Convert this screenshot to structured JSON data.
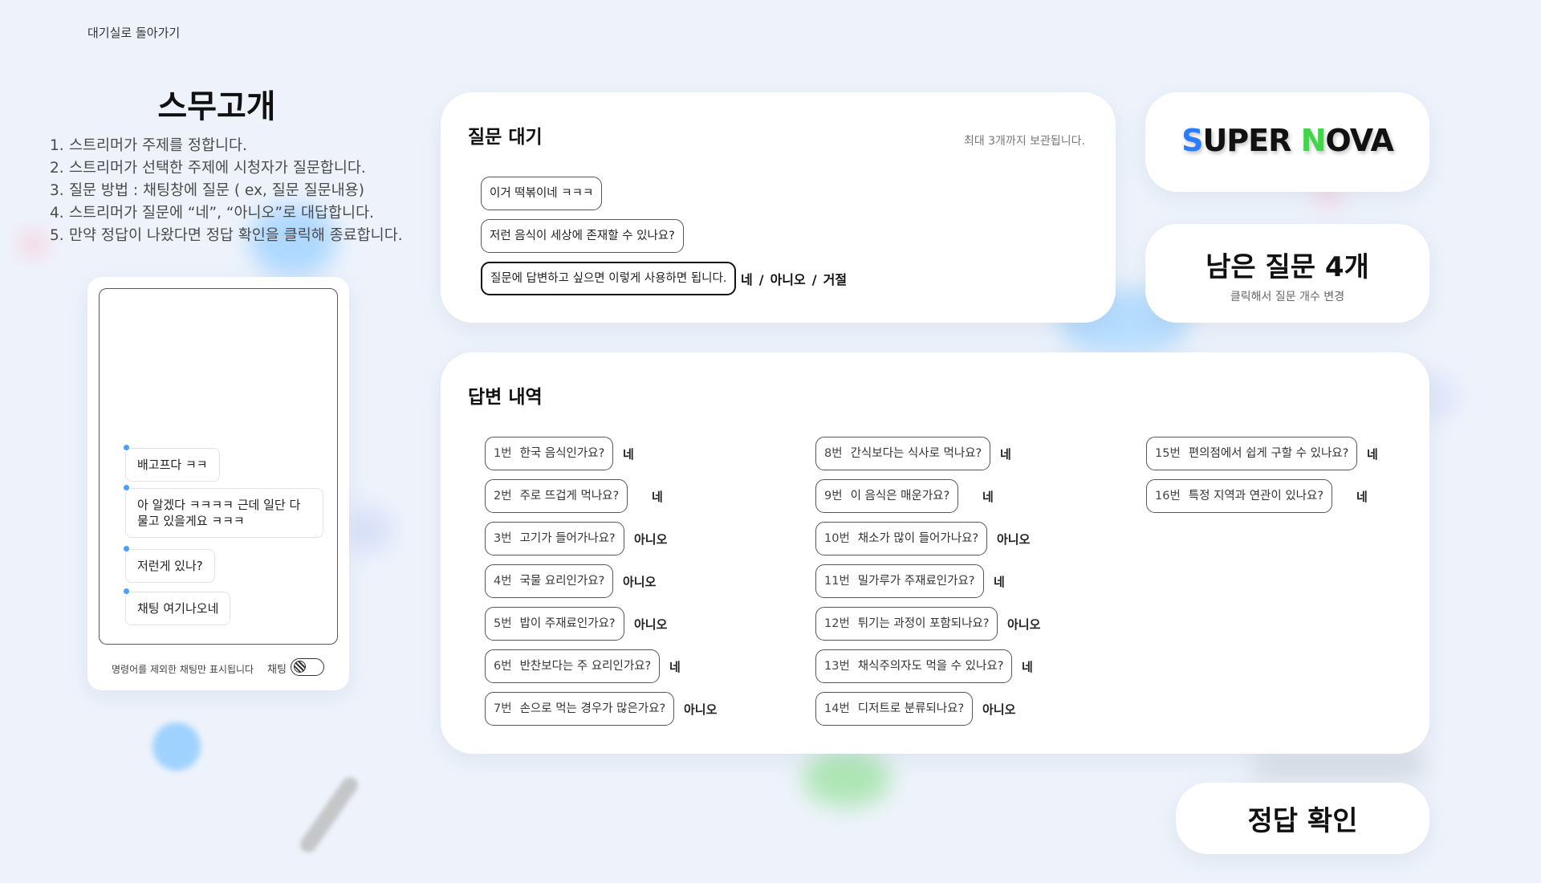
{
  "nav": {
    "back_label": "대기실로 돌아가기"
  },
  "game": {
    "title": "스무고개",
    "rules": [
      {
        "num": "1.",
        "text": "스트리머가 주제를 정합니다."
      },
      {
        "num": "2.",
        "text": "스트리머가 선택한 주제에 시청자가 질문합니다."
      },
      {
        "num": "3.",
        "text": "질문 방법 : 채팅창에 질문 ( ex, 질문 질문내용)"
      },
      {
        "num": "4.",
        "text": "스트리머가 질문에 “네”, “아니오”로 대답합니다."
      },
      {
        "num": "5.",
        "text": "만약 정답이 나왔다면 정답 확인을 클릭해 종료합니다."
      }
    ]
  },
  "chat": {
    "messages": [
      "배고프다 ㅋㅋ",
      "아 알겠다 ㅋㅋㅋㅋ 근데 일단 다물고 있을게요 ㅋㅋㅋ",
      "저런게 있나?",
      "채팅 여기나오네"
    ],
    "footer_note": "명령어를 제외한 채팅만 표시됩니다",
    "toggle_label": "채팅"
  },
  "queue": {
    "title": "질문 대기",
    "note": "최대 3개까지 보관됩니다.",
    "questions": [
      "이거 떡볶이네 ㅋㅋㅋ",
      "저런 음식이 세상에 존재할 수 있나요?",
      "질문에 답변하고 싶으면 이렇게 사용하면 됩니다."
    ],
    "options": {
      "yes": "네",
      "no": "아니오",
      "reject": "거절",
      "separator": "/"
    }
  },
  "brand": {
    "part1": "S",
    "part2": "UPER ",
    "part3": "N",
    "part4": "OVA"
  },
  "remaining": {
    "title": "남은 질문 4개",
    "subtitle": "클릭해서 질문 개수 변경",
    "count": 4
  },
  "history": {
    "title": "답변 내역",
    "items": [
      {
        "num": "1번",
        "q": "한국 음식인가요?",
        "a": "네"
      },
      {
        "num": "2번",
        "q": "주로 뜨겁게 먹나요?",
        "a": "네"
      },
      {
        "num": "3번",
        "q": "고기가 들어가나요?",
        "a": "아니오"
      },
      {
        "num": "4번",
        "q": "국물 요리인가요?",
        "a": "아니오"
      },
      {
        "num": "5번",
        "q": "밥이 주재료인가요?",
        "a": "아니오"
      },
      {
        "num": "6번",
        "q": "반찬보다는 주 요리인가요?",
        "a": "네"
      },
      {
        "num": "7번",
        "q": "손으로 먹는 경우가 많은가요?",
        "a": "아니오"
      },
      {
        "num": "8번",
        "q": "간식보다는 식사로 먹나요?",
        "a": "네"
      },
      {
        "num": "9번",
        "q": "이 음식은 매운가요?",
        "a": "네"
      },
      {
        "num": "10번",
        "q": "채소가 많이 들어가나요?",
        "a": "아니오"
      },
      {
        "num": "11번",
        "q": "밀가루가 주재료인가요?",
        "a": "네"
      },
      {
        "num": "12번",
        "q": "튀기는 과정이 포함되나요?",
        "a": "아니오"
      },
      {
        "num": "13번",
        "q": "채식주의자도 먹을 수 있나요?",
        "a": "네"
      },
      {
        "num": "14번",
        "q": "디저트로 분류되나요?",
        "a": "아니오"
      },
      {
        "num": "15번",
        "q": "편의점에서 쉽게 구할 수 있나요?",
        "a": "네"
      },
      {
        "num": "16번",
        "q": "특정 지역과 연관이 있나요?",
        "a": "네"
      }
    ]
  },
  "confirm": {
    "label": "정답 확인"
  }
}
